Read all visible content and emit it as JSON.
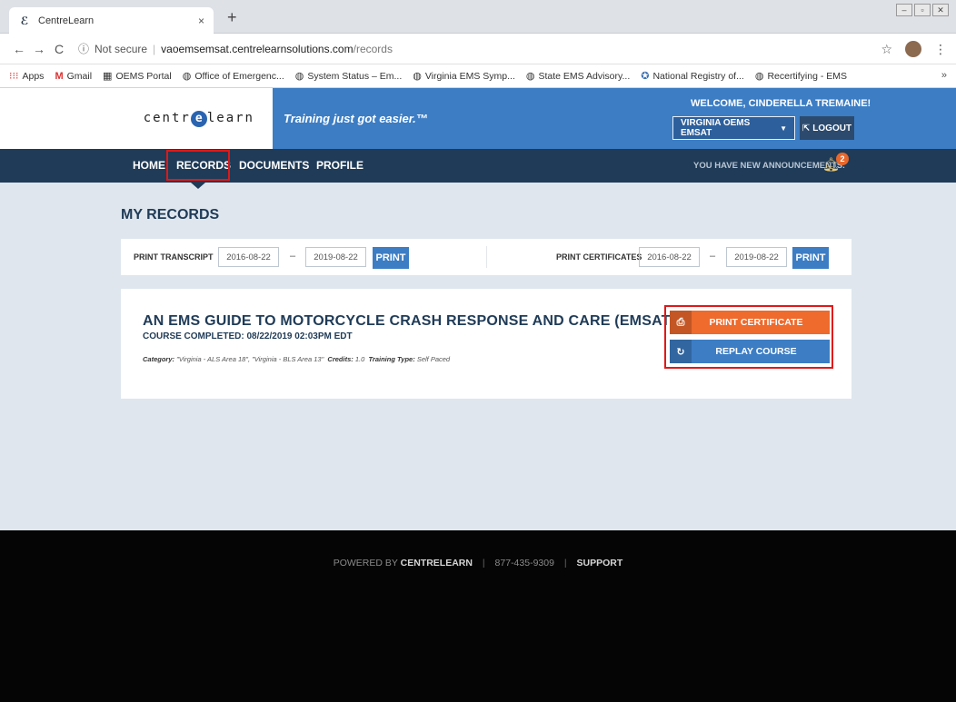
{
  "browser": {
    "tab_title": "CentreLearn",
    "tab_close": "×",
    "new_tab": "+",
    "url_security": "Not secure",
    "url_host": "vaoemsemsat.centrelearnsolutions.com",
    "url_path": "/records",
    "bookmarks": [
      "Apps",
      "Gmail",
      "OEMS Portal",
      "Office of Emergenc...",
      "System Status – Em...",
      "Virginia EMS Symp...",
      "State EMS Advisory...",
      "National Registry of...",
      "Recertifying - EMS"
    ],
    "bookmarks_more": "»"
  },
  "header": {
    "logo_left": "centr",
    "logo_e": "e",
    "logo_right": "learn",
    "tagline": "Training just got easier.™",
    "welcome_prefix": "WELCOME, ",
    "welcome_name": "CINDERELLA TREMAINE!",
    "org_select": "VIRGINIA OEMS EMSAT",
    "logout": "LOGOUT"
  },
  "nav": {
    "items": [
      "HOME",
      "RECORDS",
      "DOCUMENTS",
      "PROFILE"
    ],
    "announcement": "YOU HAVE NEW ANNOUNCEMENTS.",
    "announcement_count": "2"
  },
  "page_title": "MY RECORDS",
  "print_panel": {
    "transcript_label": "PRINT TRANSCRIPT",
    "transcript_from": "2016-08-22",
    "transcript_to": "2019-08-22",
    "certificates_label": "PRINT CERTIFICATES",
    "certificates_from": "2016-08-22",
    "certificates_to": "2019-08-22",
    "print_label": "PRINT",
    "dash": "–"
  },
  "course": {
    "title": "AN EMS GUIDE TO MOTORCYCLE CRASH RESPONSE AND CARE (EMSAT)",
    "completed": "COURSE COMPLETED: 08/22/2019 02:03PM EDT",
    "category_label": "Category:",
    "category_value": "\"Virginia - ALS Area 18\", \"Virginia - BLS Area 13\"",
    "credits_label": "Credits:",
    "credits_value": "1.0",
    "training_type_label": "Training Type:",
    "training_type_value": "Self Paced",
    "print_certificate": "PRINT CERTIFICATE",
    "replay_course": "REPLAY COURSE"
  },
  "footer": {
    "powered_by": "POWERED BY",
    "brand": "CENTRELEARN",
    "phone": "877-435-9309",
    "support": "SUPPORT"
  },
  "colors": {
    "brand_blue": "#3c7dc4",
    "nav_dark": "#1f3b57",
    "accent_orange": "#ee6a2d",
    "highlight_red": "#e01818"
  }
}
